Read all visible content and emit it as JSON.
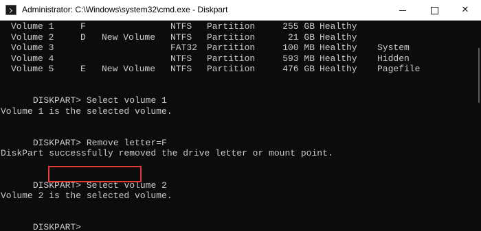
{
  "window": {
    "title": "Administrator: C:\\Windows\\system32\\cmd.exe - Diskpart",
    "controls": {
      "minimize": "minimize",
      "maximize": "maximize",
      "close": "✕"
    }
  },
  "console": {
    "volumes": [
      {
        "num": "Volume 1",
        "ltr": "F",
        "label": "",
        "fs": "NTFS",
        "type": "Partition",
        "size": "255 GB",
        "status": "Healthy",
        "info": ""
      },
      {
        "num": "Volume 2",
        "ltr": "D",
        "label": "New Volume",
        "fs": "NTFS",
        "type": "Partition",
        "size": "21 GB",
        "status": "Healthy",
        "info": ""
      },
      {
        "num": "Volume 3",
        "ltr": "",
        "label": "",
        "fs": "FAT32",
        "type": "Partition",
        "size": "100 MB",
        "status": "Healthy",
        "info": "System"
      },
      {
        "num": "Volume 4",
        "ltr": "",
        "label": "",
        "fs": "NTFS",
        "type": "Partition",
        "size": "593 MB",
        "status": "Healthy",
        "info": "Hidden"
      },
      {
        "num": "Volume 5",
        "ltr": "E",
        "label": "New Volume",
        "fs": "NTFS",
        "type": "Partition",
        "size": "476 GB",
        "status": "Healthy",
        "info": "Pagefile"
      }
    ],
    "prompt": "DISKPART>",
    "cmd1": "Select volume 1",
    "out1": "Volume 1 is the selected volume.",
    "cmd2": "Remove letter=F",
    "out2": "DiskPart successfully removed the drive letter or mount point.",
    "cmd3": "Select volume 2",
    "out3": "Volume 2 is the selected volume."
  }
}
